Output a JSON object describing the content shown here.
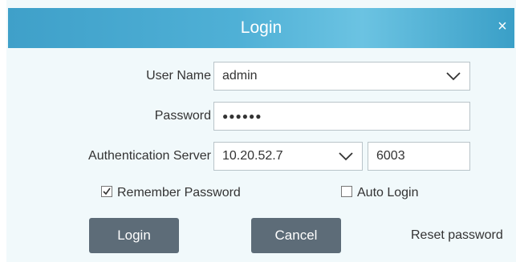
{
  "dialog": {
    "title": "Login",
    "close_glyph": "×",
    "close_icon": "close-icon"
  },
  "form": {
    "username_label": "User Name",
    "username_value": "admin",
    "password_label": "Password",
    "password_value": "●●●●●●",
    "auth_server_label": "Authentication Server",
    "auth_server_value": "10.20.52.7",
    "port_value": "6003",
    "remember_password_label": "Remember Password",
    "remember_password_checked": true,
    "auto_login_label": "Auto Login",
    "auto_login_checked": false
  },
  "actions": {
    "login_label": "Login",
    "cancel_label": "Cancel",
    "reset_password_label": "Reset password"
  },
  "colors": {
    "titlebar": "#4fb0d6",
    "dialog_bg": "#f1f9fb",
    "button_bg": "#5d6c78"
  }
}
